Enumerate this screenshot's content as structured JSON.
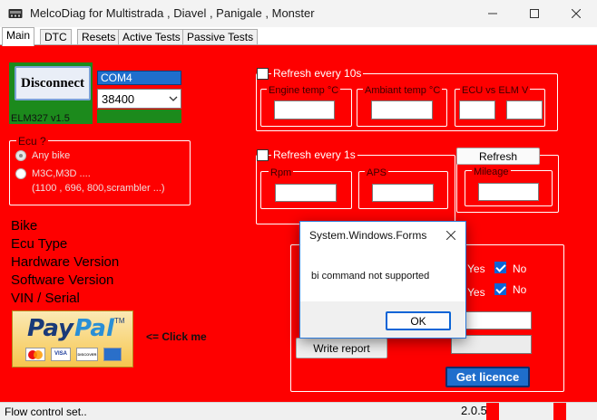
{
  "window": {
    "title": "MelcoDiag for Multistrada , Diavel , Panigale , Monster",
    "icon": "app-icon",
    "controls": {
      "minimize": "minimize-icon",
      "maximize": "maximize-icon",
      "close": "close-icon"
    }
  },
  "tabs": [
    {
      "label": "Main",
      "active": true
    },
    {
      "label": "DTC"
    },
    {
      "label": "Resets"
    },
    {
      "label": "Active Tests"
    },
    {
      "label": "Passive Tests"
    }
  ],
  "colors": {
    "background": "#fe0000",
    "green": "#1c8a1c",
    "blue_accent": "#0a64d6",
    "win_accent": "#2b78d8"
  },
  "connection": {
    "disconnect_label": "Disconnect",
    "elm_version": "ELM327 v1.5",
    "port_value": "COM4",
    "baud_value": "38400"
  },
  "ecu_group": {
    "label": "Ecu ?",
    "options": [
      {
        "label": "Any bike",
        "selected": true
      },
      {
        "label": "M3C,M3D ....",
        "sub": "(1100 , 696, 800,scrambler ...)",
        "selected": false
      }
    ]
  },
  "info_labels": [
    "Bike",
    "Ecu Type",
    "Hardware Version",
    "Software Version",
    "VIN / Serial"
  ],
  "paypal": {
    "text_pay": "Pay",
    "text_pal": "Pal",
    "tm": "TM",
    "click_me": "<= Click me",
    "cards": [
      "MasterCard",
      "VISA",
      "DISCOVER",
      "AMEX"
    ]
  },
  "refresh10": {
    "label": "Refresh every 10s",
    "fields": [
      "Engine temp °C",
      "Ambiant temp °C",
      "ECU vs ELM V"
    ]
  },
  "refresh1": {
    "label": "Refresh every 1s",
    "fields": [
      "Rpm",
      "APS"
    ],
    "refresh_button": "Refresh",
    "mileage_label": "Mileage"
  },
  "lower_group": {
    "yes_label_1": "Yes",
    "no_label_1": "No",
    "yes_label_2": "Yes",
    "no_label_2": "No",
    "write_report": "Write report",
    "get_licence": "Get licence"
  },
  "status": {
    "message": "Flow control set..",
    "version": "2.0.5.2"
  },
  "dialog": {
    "title": "System.Windows.Forms",
    "message": "bi command not supported",
    "ok_label": "OK"
  }
}
